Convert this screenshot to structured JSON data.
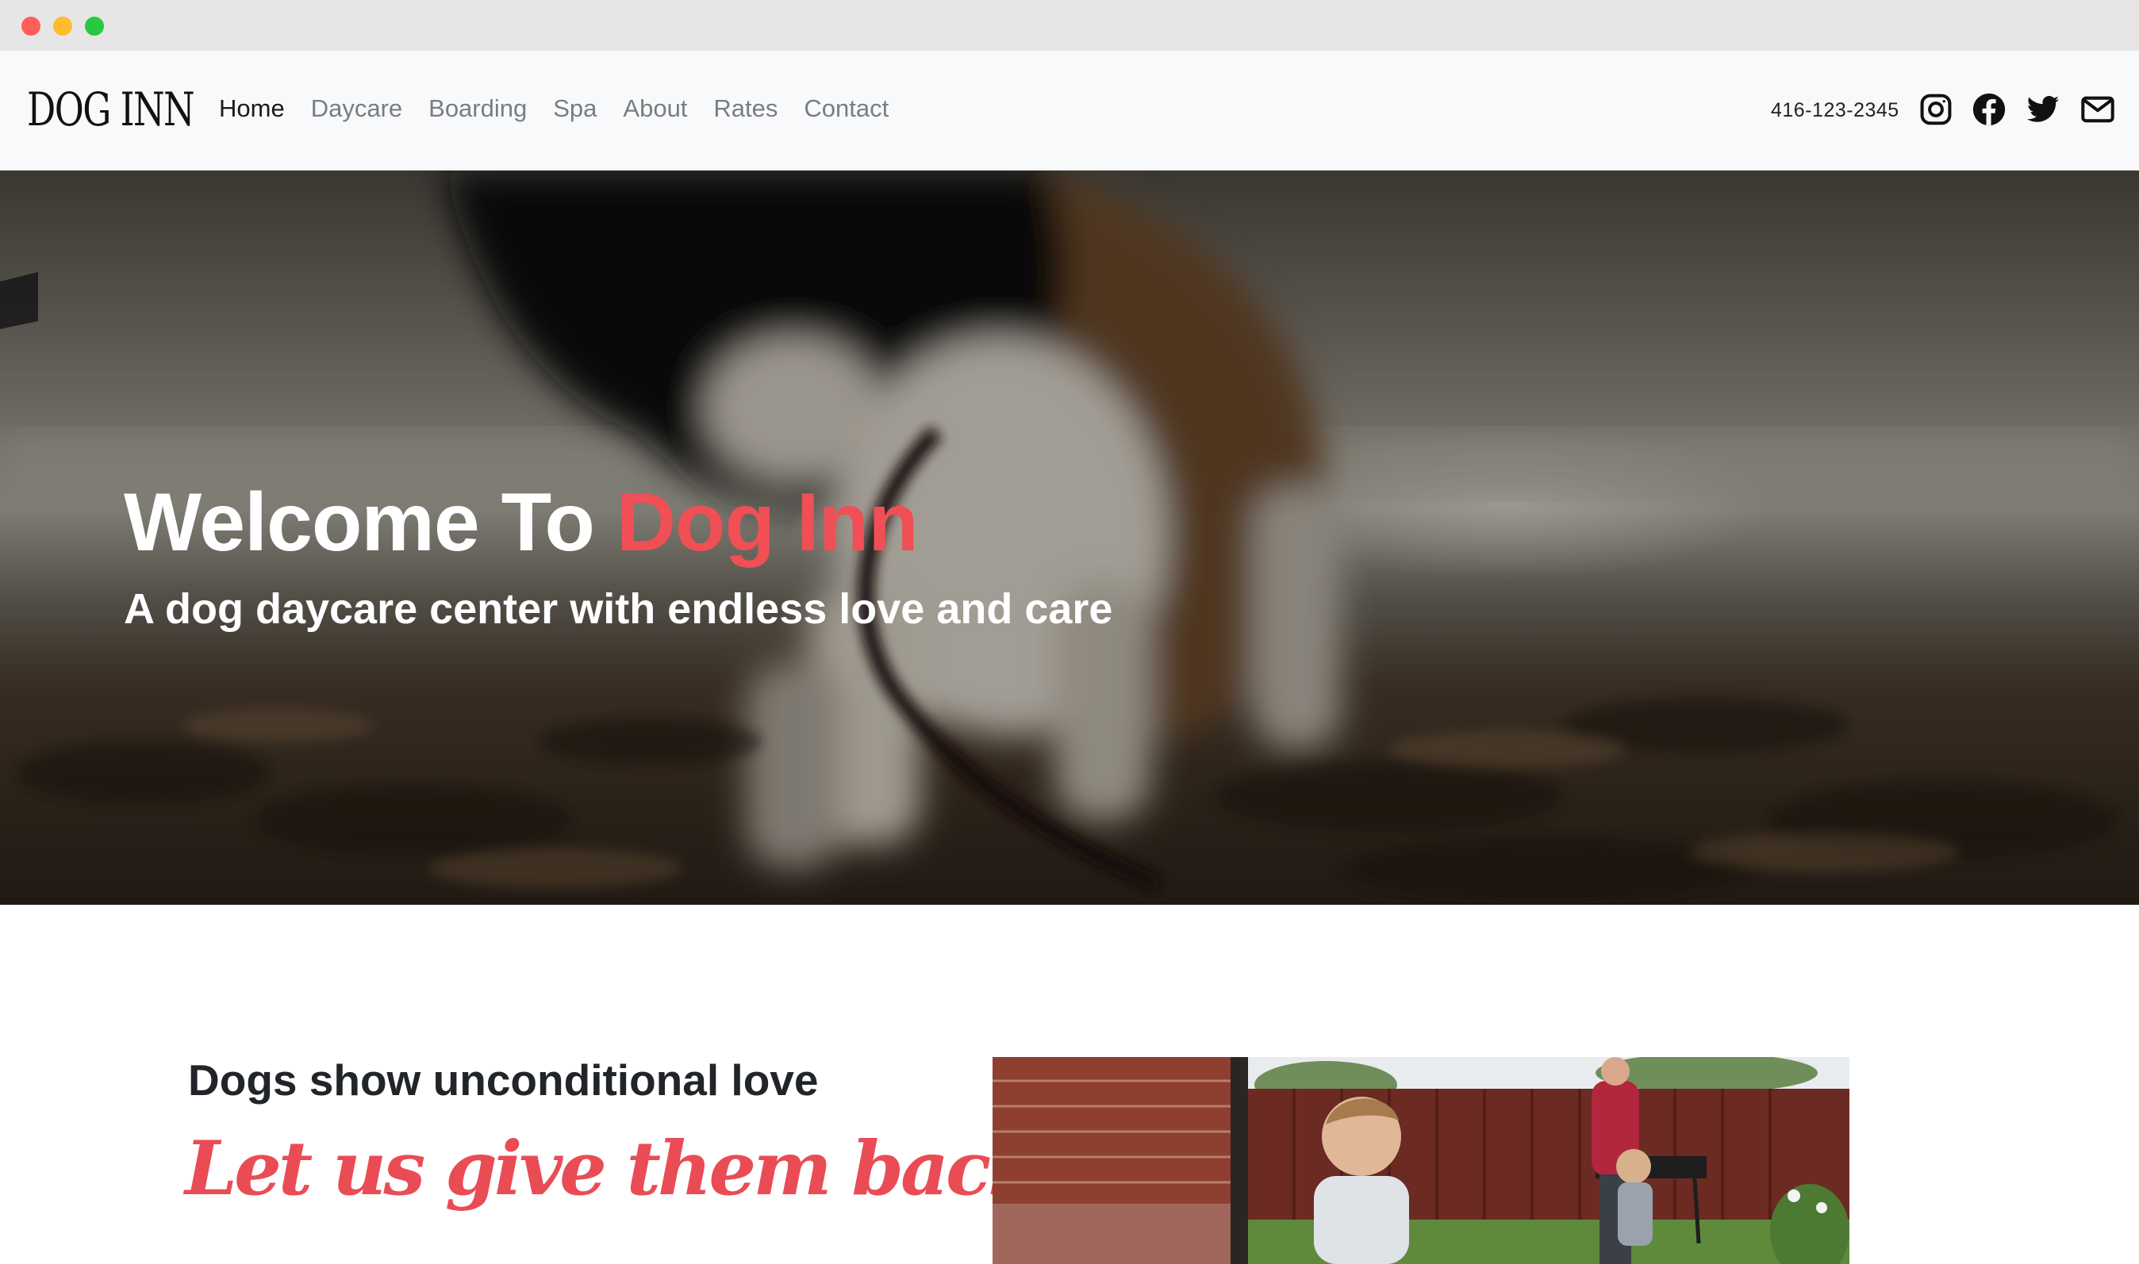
{
  "window": {
    "controls": [
      "close",
      "minimize",
      "maximize"
    ]
  },
  "navbar": {
    "brand": "DOG INN",
    "links": [
      {
        "label": "Home",
        "active": true
      },
      {
        "label": "Daycare",
        "active": false
      },
      {
        "label": "Boarding",
        "active": false
      },
      {
        "label": "Spa",
        "active": false
      },
      {
        "label": "About",
        "active": false
      },
      {
        "label": "Rates",
        "active": false
      },
      {
        "label": "Contact",
        "active": false
      }
    ],
    "phone": "416-123-2345",
    "social_icons": [
      "instagram-icon",
      "facebook-icon",
      "twitter-icon",
      "mail-icon"
    ]
  },
  "hero": {
    "title_prefix": "Welcome To ",
    "title_accent": "Dog Inn",
    "subtitle": "A dog daycare center with endless love and care",
    "accent_color": "#ef4f55"
  },
  "intro": {
    "lead": "Dogs show unconditional love",
    "script": "Let us give them back",
    "script_color": "#ea4c55"
  }
}
